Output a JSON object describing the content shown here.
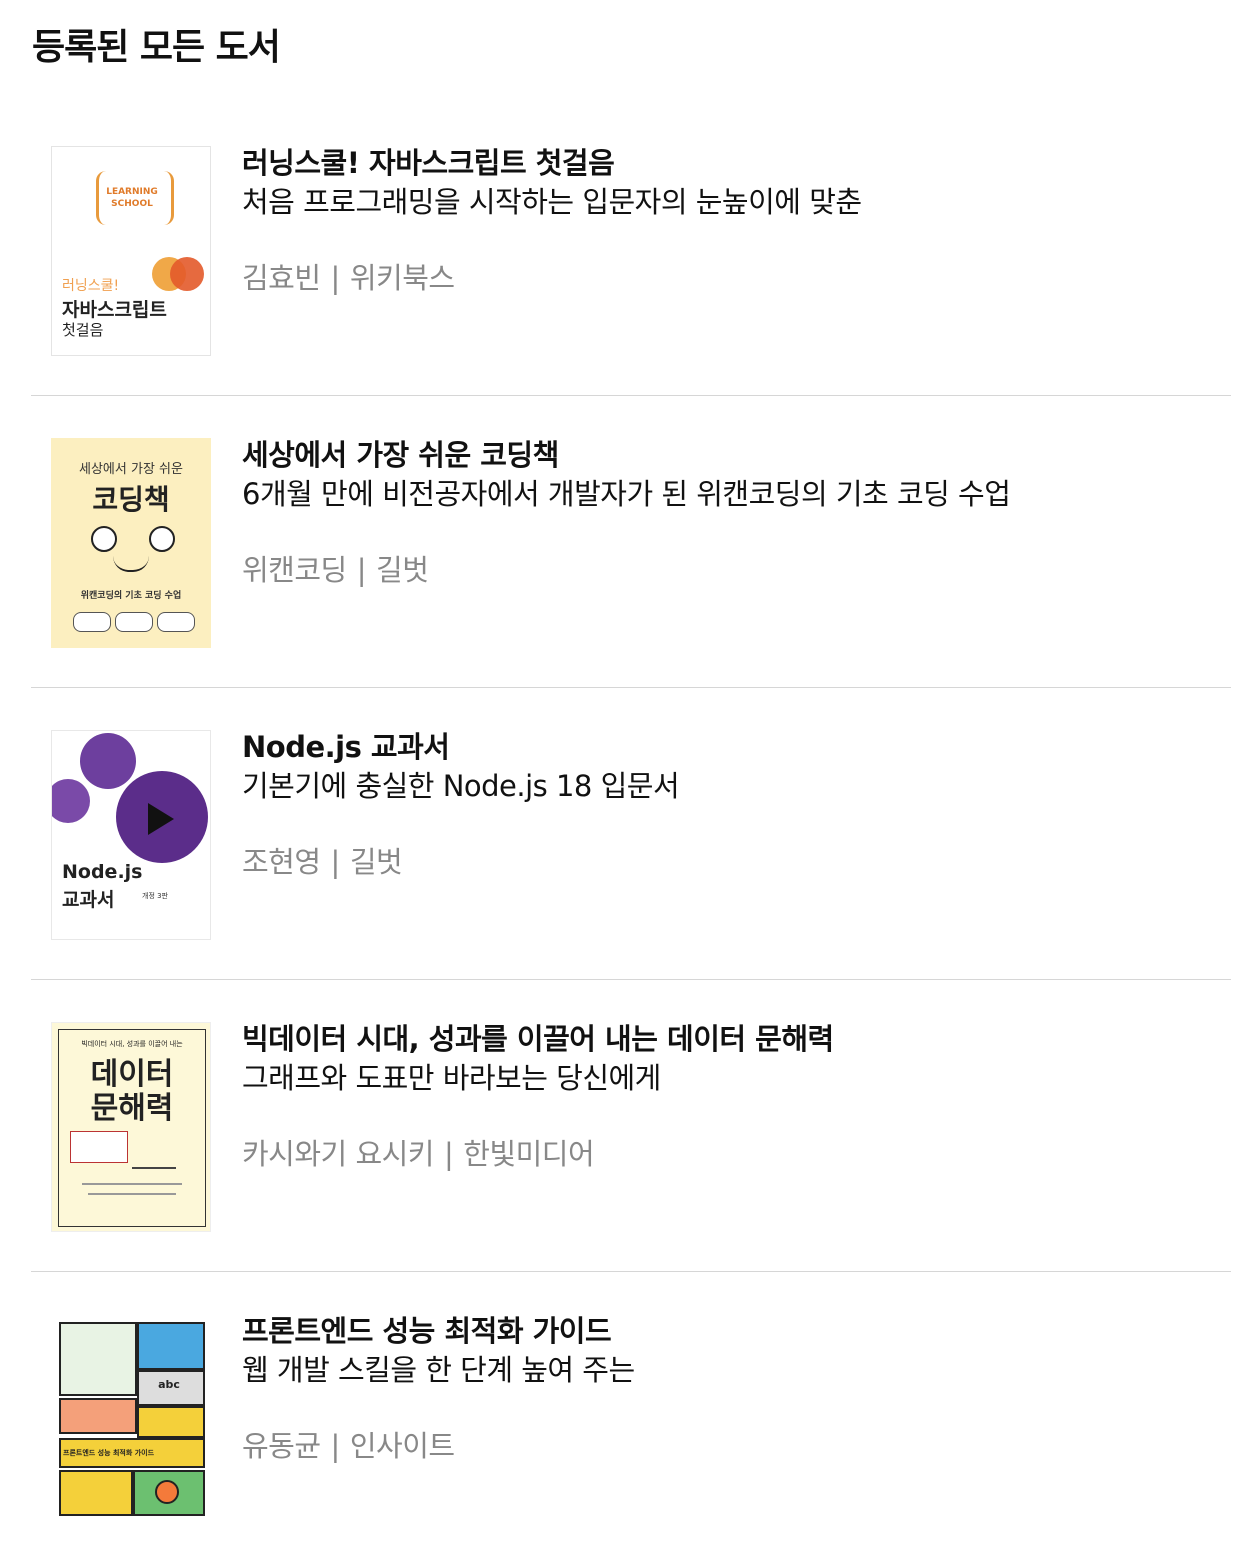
{
  "page": {
    "title": "등록된 모든 도서"
  },
  "books": [
    {
      "title": "러닝스쿨! 자바스크립트 첫걸음",
      "subtitle": "처음 프로그래밍을 시작하는 입문자의 눈높이에 맞춘",
      "author": "김효빈",
      "publisher": "위키북스",
      "cover": {
        "line1": "LEARNING",
        "line2": "SCHOOL",
        "line3": "러닝스쿨!",
        "line4": "자바스크립트",
        "line5": "첫걸음"
      }
    },
    {
      "title": "세상에서 가장 쉬운 코딩책",
      "subtitle": "6개월 만에 비전공자에서 개발자가 된 위캔코딩의 기초 코딩 수업",
      "author": "위캔코딩",
      "publisher": "길벗",
      "cover": {
        "line1": "세상에서 가장 쉬운",
        "line2": "코딩책",
        "line3": "위캔코딩의 기초 코딩 수업"
      }
    },
    {
      "title": "Node.js 교과서",
      "subtitle": "기본기에 충실한 Node.js 18 입문서",
      "author": "조현영",
      "publisher": "길벗",
      "cover": {
        "line1": "Node.js",
        "line2": "교과서",
        "line3": "개정 3판"
      }
    },
    {
      "title": "빅데이터 시대, 성과를 이끌어 내는 데이터 문해력",
      "subtitle": "그래프와 도표만 바라보는 당신에게",
      "author": "카시와기 요시키",
      "publisher": "한빛미디어",
      "cover": {
        "line1": "빅데이터 시대, 성과를 이끌어 내는",
        "line2": "데이터",
        "line3": "문해력"
      }
    },
    {
      "title": "프론트엔드 성능 최적화 가이드",
      "subtitle": "웹 개발 스킬을 한 단계 높여 주는",
      "author": "유동균",
      "publisher": "인사이트",
      "cover": {
        "line1": "abc",
        "line2": "프론트엔드 성능 최적화 가이드"
      }
    }
  ],
  "separator": "|"
}
